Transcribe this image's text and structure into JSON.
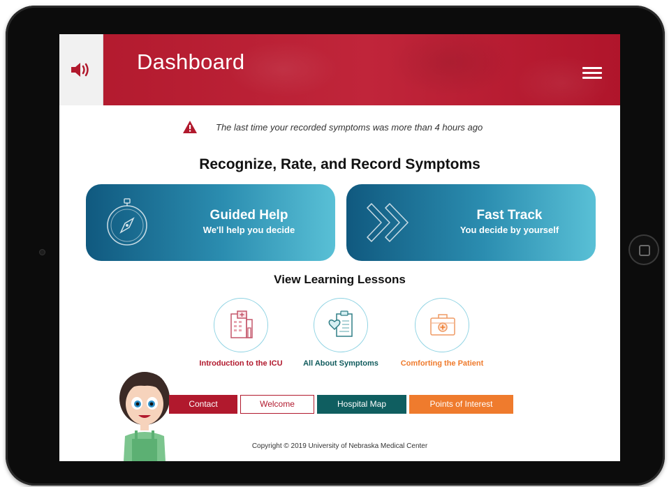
{
  "header": {
    "title": "Dashboard",
    "speaker_icon": "speaker-volume-icon",
    "menu_icon": "hamburger-menu-icon",
    "color": "#b1192d"
  },
  "alert": {
    "icon": "warning-triangle-icon",
    "text": "The last time your recorded symptoms was more than 4 hours ago"
  },
  "symptoms_section": {
    "title": "Recognize, Rate, and Record Symptoms",
    "cards": [
      {
        "title": "Guided Help",
        "subtitle": "We'll help you decide",
        "icon": "compass-icon"
      },
      {
        "title": "Fast Track",
        "subtitle": "You decide by yourself",
        "icon": "double-chevron-right-icon"
      }
    ]
  },
  "lessons_section": {
    "title": "View Learning Lessons",
    "items": [
      {
        "label": "Introduction to the ICU",
        "icon": "hospital-building-icon",
        "color": "#b1192d"
      },
      {
        "label": "All About Symptoms",
        "icon": "clipboard-heart-icon",
        "color": "#0f5a5c"
      },
      {
        "label": "Comforting the Patient",
        "icon": "first-aid-kit-icon",
        "color": "#ef7b2d"
      }
    ]
  },
  "nav": {
    "contact": "Contact",
    "welcome": "Welcome",
    "hospital_map": "Hospital Map",
    "points_of_interest": "Points of Interest"
  },
  "footer": {
    "copyright": "Copyright © 2019 University of Nebraska Medical Center"
  },
  "colors": {
    "red": "#b1192d",
    "teal": "#0f5e60",
    "orange": "#ef7b2d",
    "card_gradient_start": "#10597f",
    "card_gradient_end": "#59c0d6"
  }
}
